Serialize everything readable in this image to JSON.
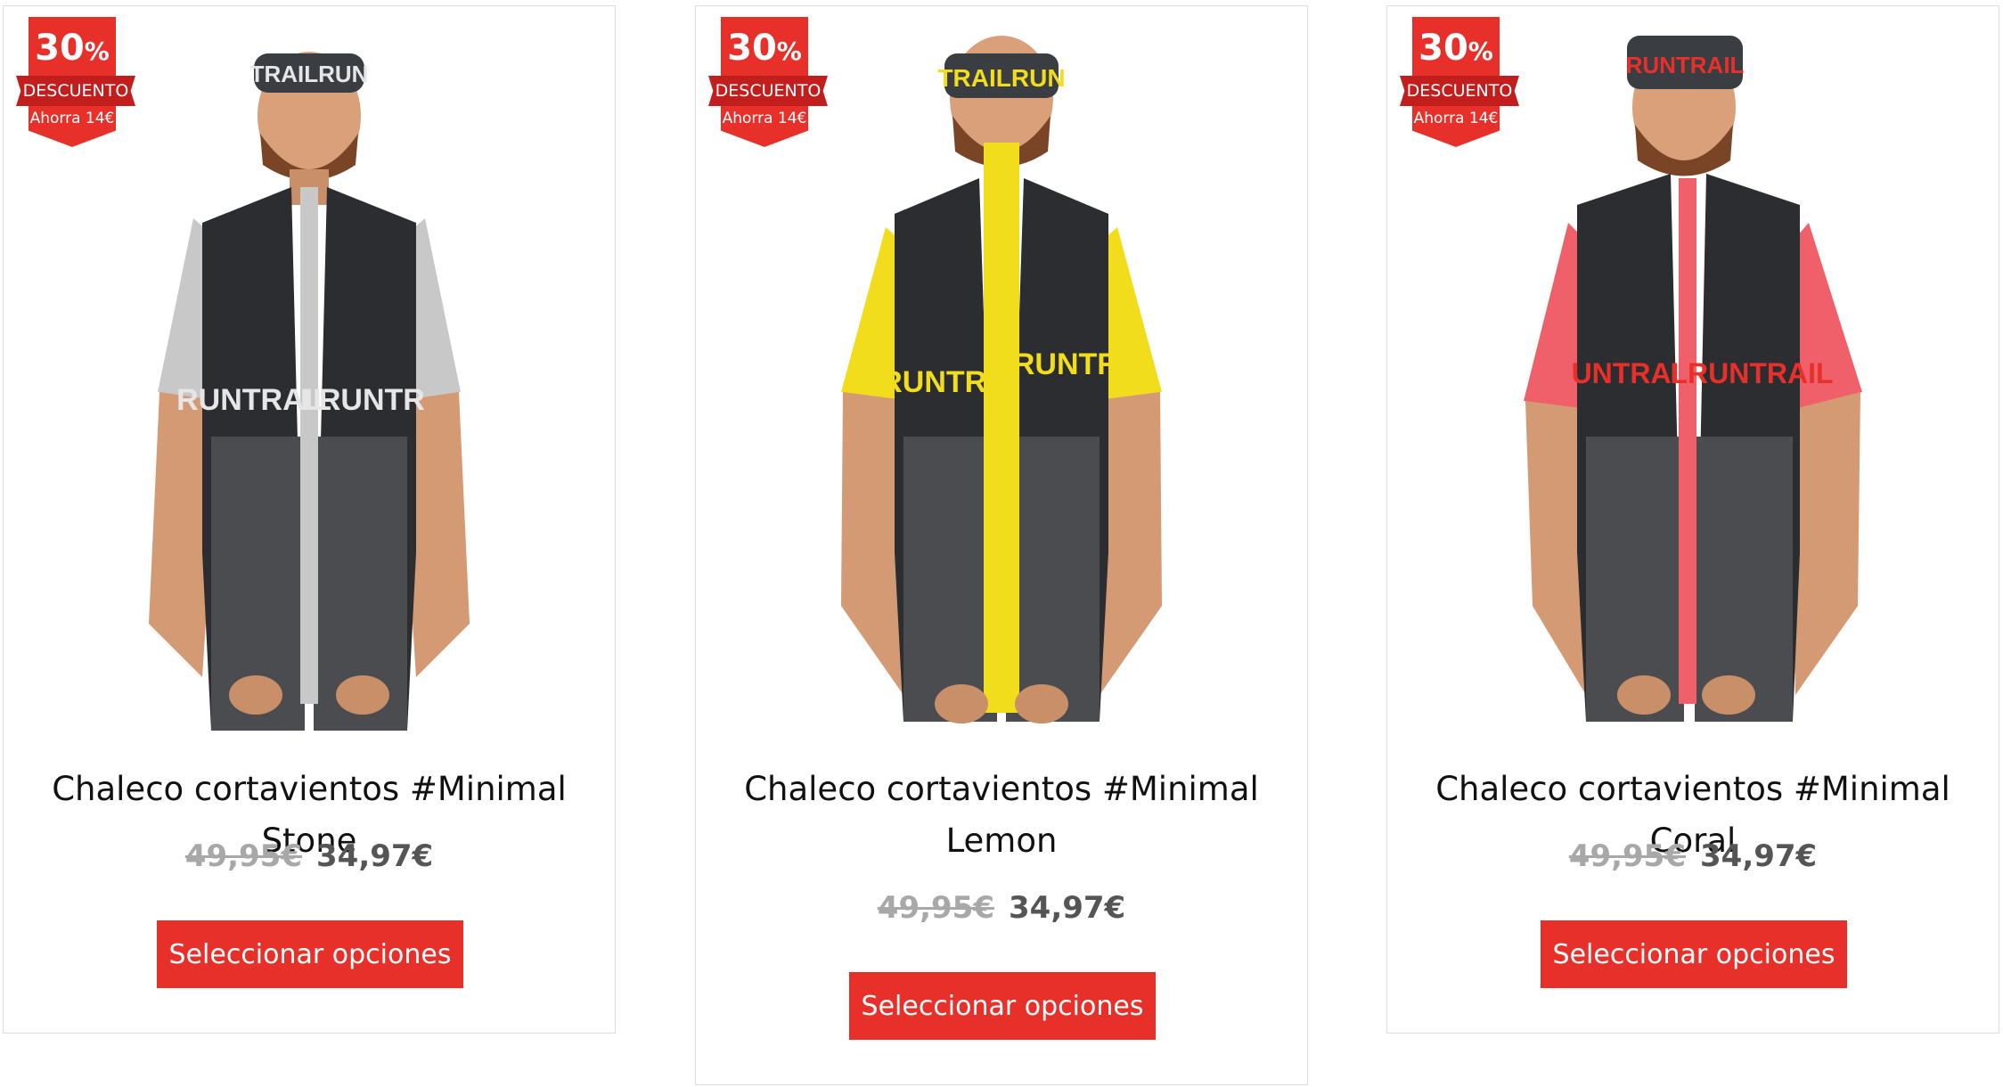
{
  "products": [
    {
      "badge": {
        "percent": "30",
        "percent_sign": "%",
        "label": "DESCUENTO",
        "savings": "Ahorra 14€"
      },
      "title": "Chaleco cortavientos #Minimal Stone",
      "old_price": "49,95€",
      "price": "34,97€",
      "button_label": "Seleccionar opciones",
      "accent_color": "#c8c8c8",
      "vest_text_color": "#e6e6e6",
      "print_left": "RUNTRAIL",
      "print_right": "LRUNTR",
      "headband": "TRAILRUN"
    },
    {
      "badge": {
        "percent": "30",
        "percent_sign": "%",
        "label": "DESCUENTO",
        "savings": "Ahorra 14€"
      },
      "title": "Chaleco cortavientos #Minimal Lemon",
      "old_price": "49,95€",
      "price": "34,97€",
      "button_label": "Seleccionar opciones",
      "accent_color": "#f2dd1c",
      "vest_text_color": "#f2dd1c",
      "print_left": "RUNTRA",
      "print_right": "LRUNTR",
      "headband": "TRAILRUN"
    },
    {
      "badge": {
        "percent": "30",
        "percent_sign": "%",
        "label": "DESCUENTO",
        "savings": "Ahorra 14€"
      },
      "title": "Chaleco cortavientos #Minimal Coral",
      "old_price": "49,95€",
      "price": "34,97€",
      "button_label": "Seleccionar opciones",
      "accent_color": "#f0606a",
      "vest_text_color": "#e8302a",
      "print_left": "UNTRAI",
      "print_right": "LRUNTRAIL",
      "headband": "RUNTRAIL"
    }
  ],
  "colors": {
    "button_bg": "#e8302a",
    "badge_red": "#e8302a",
    "badge_ribbon": "#c21e1e",
    "old_price": "#a8a8a8",
    "price": "#555555"
  }
}
